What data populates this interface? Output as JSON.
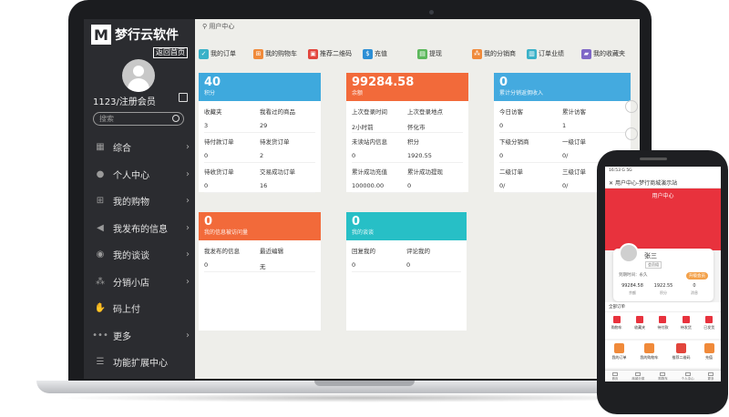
{
  "brand": {
    "name": "梦行云软件",
    "mark": "M",
    "home_link": "返回首页"
  },
  "user": {
    "name": "1123/注册会员"
  },
  "search": {
    "placeholder": "搜索"
  },
  "menu": [
    {
      "icon": "grid-icon",
      "label": "综合"
    },
    {
      "icon": "user-icon",
      "label": "个人中心"
    },
    {
      "icon": "cart-icon",
      "label": "我的购物"
    },
    {
      "icon": "megaphone-icon",
      "label": "我发布的信息"
    },
    {
      "icon": "chat-icon",
      "label": "我的谈谈"
    },
    {
      "icon": "network-icon",
      "label": "分销小店"
    },
    {
      "icon": "thumb-icon",
      "label": "码上付"
    },
    {
      "icon": "dots-icon",
      "label": "更多"
    },
    {
      "icon": "list-icon",
      "label": "功能扩展中心"
    }
  ],
  "breadcrumb": "用户中心",
  "tabs": [
    {
      "label": "我的订单",
      "color": "#3ab1c8"
    },
    {
      "label": "我的购物车",
      "color": "#f08a3a"
    },
    {
      "label": "推荐二维码",
      "color": "#e2453c"
    },
    {
      "label": "充值",
      "color": "#2d8fd5"
    },
    {
      "label": "提现",
      "color": "#5cb85c"
    },
    {
      "label": "我的分销商",
      "color": "#f08a3a"
    },
    {
      "label": "订单业绩",
      "color": "#3ab1c8"
    },
    {
      "label": "我的收藏夹",
      "color": "#7f67c7"
    }
  ],
  "cards": [
    {
      "big": "40",
      "sub": "积分",
      "color": "#3ea9dd",
      "rows": [
        [
          "收藏夹",
          "我看过的商品"
        ],
        [
          "3",
          "29"
        ],
        [
          "待付款订单",
          "待发货订单"
        ],
        [
          "0",
          "2"
        ],
        [
          "待收货订单",
          "交易成功订单"
        ],
        [
          "0",
          "16"
        ]
      ]
    },
    {
      "big": "99284.58",
      "sub": "余额",
      "color": "#f26a3a",
      "rows": [
        [
          "上次登录时间",
          "上次登录地点"
        ],
        [
          "2小时前",
          "怀化市"
        ],
        [
          "未读站内信息",
          "积分"
        ],
        [
          "0",
          "1920.55"
        ],
        [
          "累计成功充值",
          "累计成功提现"
        ],
        [
          "100000.00",
          "0"
        ]
      ]
    },
    {
      "big": "0",
      "sub": "累计分销返佣收入",
      "color": "#44aadf",
      "rows": [
        [
          "今日访客",
          "累计访客"
        ],
        [
          "0",
          "1"
        ],
        [
          "下级分销商",
          "一级订单"
        ],
        [
          "0",
          "0/"
        ],
        [
          "二级订单",
          "三级订单"
        ],
        [
          "0/",
          "0/"
        ]
      ]
    },
    {
      "big": "0",
      "sub": "我的信息被访问量",
      "color": "#f26a3a",
      "rows": [
        [
          "我发布的信息",
          "最近编辑"
        ],
        [
          "0",
          "无"
        ]
      ]
    },
    {
      "big": "0",
      "sub": "我的谈谈",
      "color": "#27bfc6",
      "rows": [
        [
          "回复我的",
          "评论我的"
        ],
        [
          "0",
          "0"
        ]
      ]
    }
  ],
  "phone": {
    "status": "16:53 G 5G",
    "title": "用户中心-梦行商城演示站",
    "header": "用户中心",
    "name": "张三",
    "tag": "会员组",
    "expiry": "到期时间：永久",
    "upgrade": "升级会员",
    "stats": [
      {
        "v": "99284.58",
        "l": "余额"
      },
      {
        "v": "1922.55",
        "l": "积分"
      },
      {
        "v": "0",
        "l": "消息"
      }
    ],
    "orders_title": "全部订单",
    "orders": [
      "购物车",
      "收藏夹",
      "待付款",
      "待发货",
      "已发货"
    ],
    "funcs": [
      {
        "l": "我的订单",
        "c": "#f08a3a"
      },
      {
        "l": "我的购物车",
        "c": "#f08a3a"
      },
      {
        "l": "推荐二维码",
        "c": "#e2453c"
      },
      {
        "l": "充值",
        "c": "#f08a3a"
      }
    ],
    "nav": [
      "首页",
      "商城分类",
      "购物车",
      "个人中心",
      "更多"
    ]
  }
}
